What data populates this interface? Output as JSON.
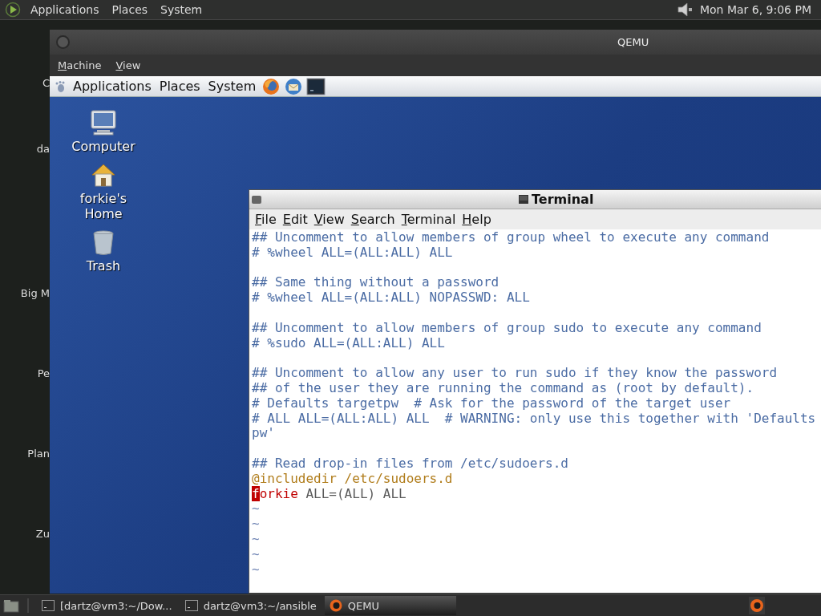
{
  "top_panel": {
    "menus": [
      "Applications",
      "Places",
      "System"
    ],
    "clock": "Mon Mar  6, 9:06 PM"
  },
  "host_desktop": {
    "labels": [
      "C",
      "da",
      "Big M",
      "Pe",
      "Plan",
      "Zu"
    ]
  },
  "qemu_window": {
    "title": "QEMU",
    "menus": [
      "Machine",
      "View"
    ]
  },
  "guest_panel": {
    "menus": [
      "Applications",
      "Places",
      "System"
    ]
  },
  "guest_desktop": {
    "icons": [
      {
        "kind": "computer",
        "label": "Computer"
      },
      {
        "kind": "home",
        "label": "forkie's Home"
      },
      {
        "kind": "trash",
        "label": "Trash"
      }
    ]
  },
  "terminal": {
    "title": "Terminal",
    "menus": [
      "File",
      "Edit",
      "View",
      "Search",
      "Terminal",
      "Help"
    ],
    "lines": [
      {
        "segments": [
          {
            "kind": "comment",
            "text": "## Uncomment to allow members of group wheel to execute any command"
          }
        ]
      },
      {
        "segments": [
          {
            "kind": "comment",
            "text": "# %wheel ALL=(ALL:ALL) ALL"
          }
        ]
      },
      {
        "kind": "blank"
      },
      {
        "segments": [
          {
            "kind": "comment",
            "text": "## Same thing without a password"
          }
        ]
      },
      {
        "segments": [
          {
            "kind": "comment",
            "text": "# %wheel ALL=(ALL:ALL) NOPASSWD: ALL"
          }
        ]
      },
      {
        "kind": "blank"
      },
      {
        "segments": [
          {
            "kind": "comment",
            "text": "## Uncomment to allow members of group sudo to execute any command"
          }
        ]
      },
      {
        "segments": [
          {
            "kind": "comment",
            "text": "# %sudo ALL=(ALL:ALL) ALL"
          }
        ]
      },
      {
        "kind": "blank"
      },
      {
        "segments": [
          {
            "kind": "comment",
            "text": "## Uncomment to allow any user to run sudo if they know the password"
          }
        ]
      },
      {
        "segments": [
          {
            "kind": "comment",
            "text": "## of the user they are running the command as (root by default)."
          }
        ]
      },
      {
        "segments": [
          {
            "kind": "comment",
            "text": "# Defaults targetpw  # Ask for the password of the target user"
          }
        ]
      },
      {
        "segments": [
          {
            "kind": "comment",
            "text": "# ALL ALL=(ALL:ALL) ALL  # WARNING: only use this together with 'Defaults"
          }
        ]
      },
      {
        "segments": [
          {
            "kind": "comment",
            "text": "pw'"
          }
        ]
      },
      {
        "kind": "blank"
      },
      {
        "segments": [
          {
            "kind": "comment",
            "text": "## Read drop-in files from /etc/sudoers.d"
          }
        ]
      },
      {
        "segments": [
          {
            "kind": "preproc",
            "text": "@includedir /etc/sudoers.d"
          }
        ]
      },
      {
        "segments": [
          {
            "kind": "cursor",
            "text": "f"
          },
          {
            "kind": "identifier",
            "text": "orkie"
          },
          {
            "kind": "plain",
            "text": " ALL=(ALL) ALL"
          }
        ]
      },
      {
        "segments": [
          {
            "kind": "nontext",
            "text": "~"
          }
        ]
      },
      {
        "segments": [
          {
            "kind": "nontext",
            "text": "~"
          }
        ]
      },
      {
        "segments": [
          {
            "kind": "nontext",
            "text": "~"
          }
        ]
      },
      {
        "segments": [
          {
            "kind": "nontext",
            "text": "~"
          }
        ]
      },
      {
        "segments": [
          {
            "kind": "nontext",
            "text": "~"
          }
        ]
      }
    ]
  },
  "taskbar": {
    "items": [
      {
        "kind": "terminal",
        "label": "[dartz@vm3:~/Dow...",
        "selected": false
      },
      {
        "kind": "terminal",
        "label": "dartz@vm3:~/ansible",
        "selected": false
      },
      {
        "kind": "qemu",
        "label": "QEMU",
        "selected": true
      }
    ]
  }
}
